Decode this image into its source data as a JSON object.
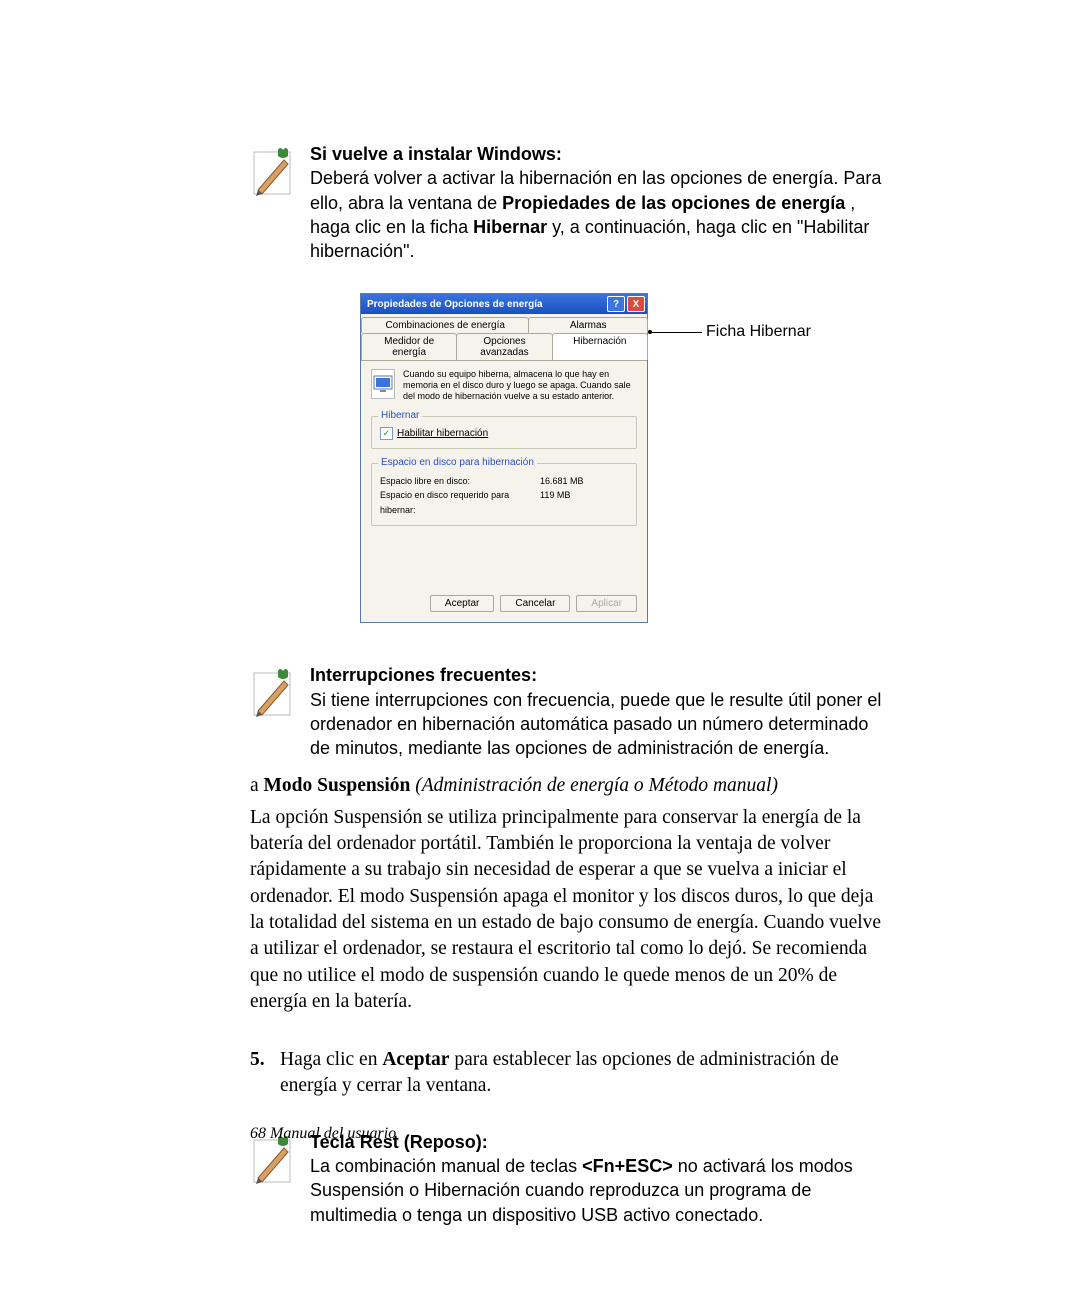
{
  "note1": {
    "title": "Si vuelve a instalar Windows:",
    "p1a": "Deberá volver a activar la hibernación en las opciones de energía. Para ello, abra la ventana de ",
    "p1b": "Propiedades de las opciones de energía",
    "p1c": " , haga clic en la ficha ",
    "p1d": "Hibernar",
    "p1e": " y, a continuación, haga clic en \"Habilitar hibernación\"."
  },
  "dialog": {
    "title": "Propiedades de Opciones de energía",
    "help": "?",
    "close": "X",
    "tabs_row1": [
      "Combinaciones de energía",
      "Alarmas"
    ],
    "tabs_row2": [
      "Medidor de energía",
      "Opciones avanzadas",
      "Hibernación"
    ],
    "desc": "Cuando su equipo hiberna, almacena lo que hay en memoria en el disco duro y luego se apaga. Cuando sale del modo de hibernación vuelve a su estado anterior.",
    "group1": {
      "legend": "Hibernar",
      "chk": "Habilitar hibernación"
    },
    "group2": {
      "legend": "Espacio en disco para hibernación",
      "k1": "Espacio libre en disco:",
      "v1": "16.681 MB",
      "k2": "Espacio en disco requerido para hibernar:",
      "v2": "119 MB"
    },
    "btn_ok": "Aceptar",
    "btn_cancel": "Cancelar",
    "btn_apply": "Aplicar"
  },
  "callout": "Ficha Hibernar",
  "note2": {
    "title": "Interrupciones frecuentes:",
    "text": "Si tiene interrupciones con frecuencia, puede que le resulte útil poner el ordenador en hibernación automática pasado un número determinado de minutos, mediante las opciones de administración de energía."
  },
  "subhead": {
    "prefix": "a ",
    "bold": "Modo Suspensión",
    "italic": " (Administración de energía o Método manual)"
  },
  "para": "La opción Suspensión se utiliza principalmente para conservar la energía de la batería del ordenador portátil. También le proporciona la ventaja de volver rápidamente a su trabajo sin necesidad de esperar a que se vuelva a iniciar el ordenador. El modo Suspensión apaga el monitor y los discos duros, lo que deja la totalidad del sistema en un estado de bajo consumo de energía. Cuando vuelve a utilizar el ordenador, se restaura el escritorio tal como lo dejó. Se recomienda que no utilice el modo de suspensión cuando le quede menos de un 20% de energía en la batería.",
  "step5": {
    "num": "5.",
    "a": "Haga clic en ",
    "b": "Aceptar",
    "c": " para establecer las opciones de administración de energía y cerrar la ventana."
  },
  "note3": {
    "title": "Tecla Rest (Reposo):",
    "a": "La combinación manual de teclas ",
    "b": "<Fn+ESC>",
    "c": " no activará los modos Suspensión o Hibernación cuando reproduzca un programa de multimedia o tenga un dispositivo USB activo conectado."
  },
  "footer": "68  Manual del usuario"
}
